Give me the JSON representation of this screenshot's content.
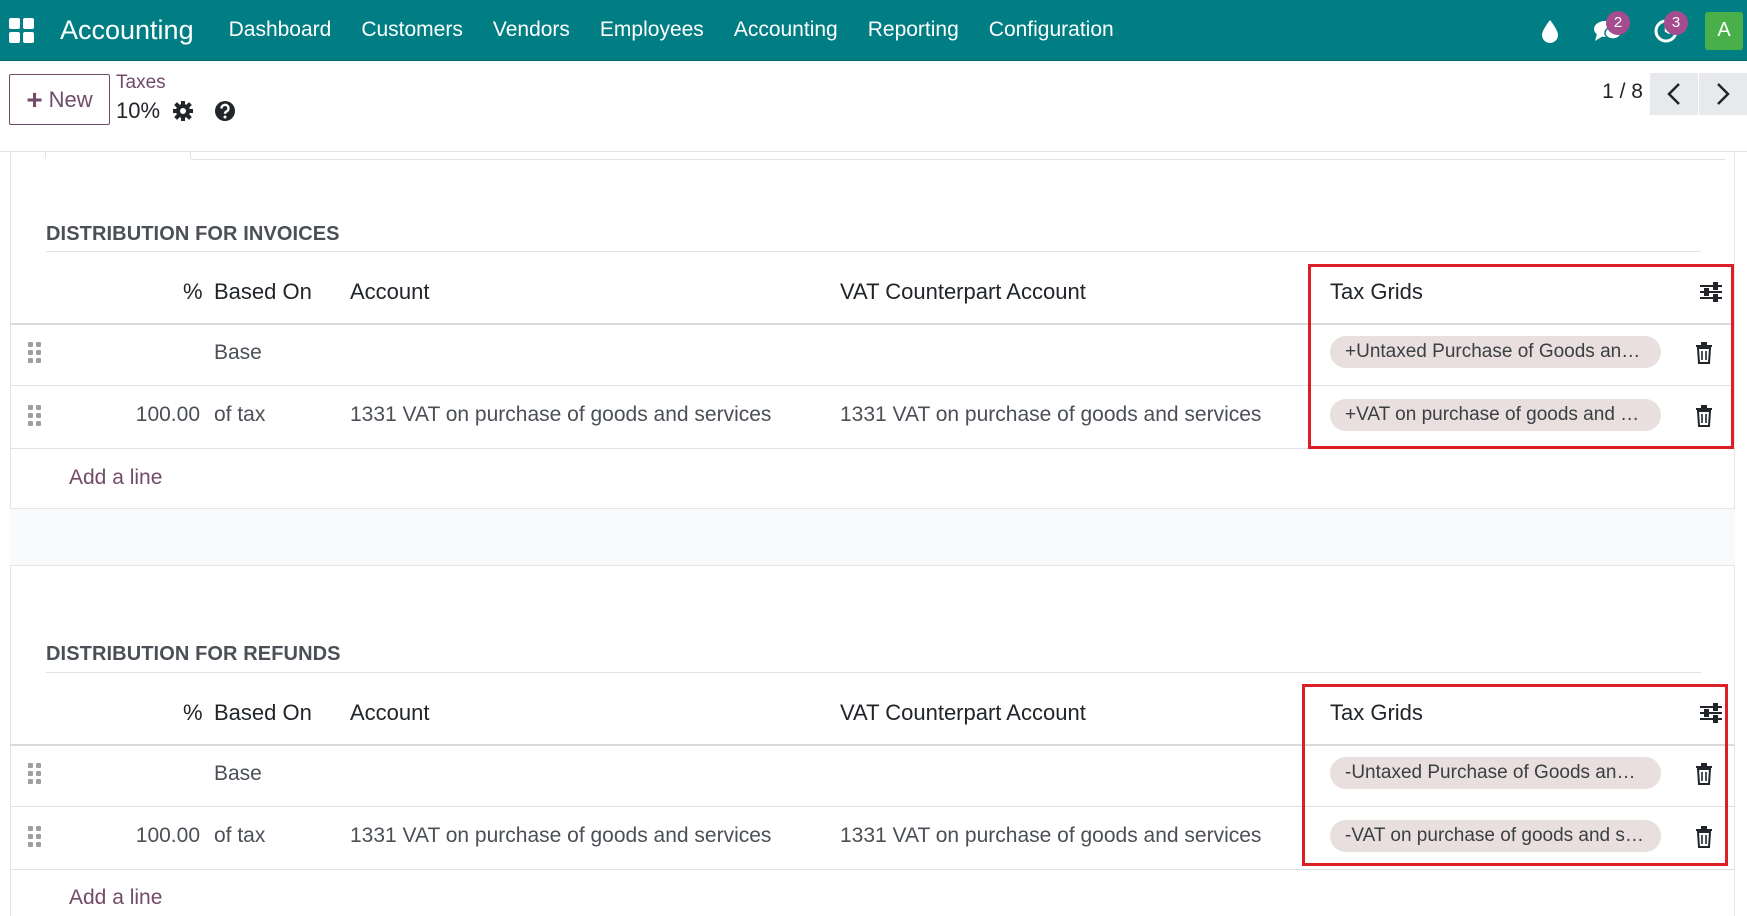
{
  "navbar": {
    "apps_icon": "apps-grid-icon",
    "brand": "Accounting",
    "menu": [
      "Dashboard",
      "Customers",
      "Vendors",
      "Employees",
      "Accounting",
      "Reporting",
      "Configuration"
    ],
    "icons": [
      "drop-icon",
      "chat-icon",
      "clock-icon"
    ],
    "chat_badge": "2",
    "activity_badge": "3",
    "avatar_letter": "A",
    "color": "#017e84"
  },
  "control_panel": {
    "new_label": "New",
    "breadcrumb_parent": "Taxes",
    "record_title": "10%",
    "pager_value": "1 / 8"
  },
  "invoices": {
    "title": "DISTRIBUTION FOR INVOICES",
    "headers": {
      "percent": "%",
      "based_on": "Based On",
      "account": "Account",
      "vat_counterpart": "VAT Counterpart Account",
      "tax_grids": "Tax Grids"
    },
    "rows": [
      {
        "percent": "",
        "based_on": "Base",
        "account": "",
        "vat_counterpart": "",
        "tax_grid": "+Untaxed Purchase of Goods and Services"
      },
      {
        "percent": "100.00",
        "based_on": "of tax",
        "account": "1331 VAT on purchase of goods and services",
        "vat_counterpart": "1331 VAT on purchase of goods and services",
        "tax_grid": "+VAT on purchase of goods and services"
      }
    ],
    "add_line": "Add a line"
  },
  "refunds": {
    "title": "DISTRIBUTION FOR REFUNDS",
    "headers": {
      "percent": "%",
      "based_on": "Based On",
      "account": "Account",
      "vat_counterpart": "VAT Counterpart Account",
      "tax_grids": "Tax Grids"
    },
    "rows": [
      {
        "percent": "",
        "based_on": "Base",
        "account": "",
        "vat_counterpart": "",
        "tax_grid": "-Untaxed Purchase of Goods and Services"
      },
      {
        "percent": "100.00",
        "based_on": "of tax",
        "account": "1331 VAT on purchase of goods and services",
        "vat_counterpart": "1331 VAT on purchase of goods and services",
        "tax_grid": "-VAT on purchase of goods and services"
      }
    ],
    "add_line": "Add a line"
  },
  "colors": {
    "accent": "#714b67",
    "highlight": "#dc1f26",
    "tag_bg": "#e8dfde"
  }
}
